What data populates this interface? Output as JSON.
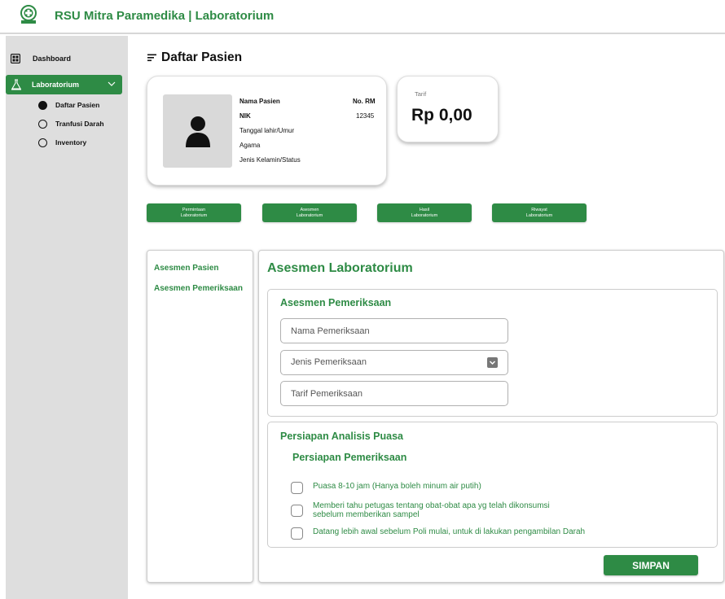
{
  "app": {
    "title": "RSU Mitra Paramedika | Laboratorium",
    "logo_icon": "hospital-logo-icon",
    "brand_color": "#2e8b45"
  },
  "sidebar": {
    "dashboard": {
      "label": "Dashboard",
      "icon": "dashboard-grid-icon"
    },
    "laboratorium": {
      "label": "Laboratorium",
      "icon": "lab-icon",
      "expanded": true
    },
    "sub_items": [
      {
        "label": "Daftar Pasien",
        "selected": true
      },
      {
        "label": "Tranfusi Darah",
        "selected": false
      },
      {
        "label": "Inventory",
        "selected": false
      }
    ]
  },
  "page": {
    "title": "Daftar Pasien",
    "title_icon": "list-lines-icon"
  },
  "patient": {
    "name_label": "Nama Pasien",
    "nik_label": "NIK",
    "birth_label": "Tanggal lahir/Umur",
    "religion_label": "Agama",
    "gender_label": "Jenis Kelamin/Status",
    "rm_label": "No. RM",
    "rm_value": "12345",
    "avatar_icon": "user-silhouette-icon"
  },
  "tariff": {
    "label": "Tarif",
    "value": "Rp 0,00"
  },
  "tabs": [
    {
      "line1": "Permintaan",
      "line2": "Laboratorium"
    },
    {
      "line1": "Asesmen",
      "line2": "Laboratorium"
    },
    {
      "line1": "Hasil",
      "line2": "Laboratorium"
    },
    {
      "line1": "Riwayat",
      "line2": "Laboratorium"
    }
  ],
  "left_menu": [
    {
      "label": "Asesmen Pasien"
    },
    {
      "label": "Asesmen Pemeriksaan"
    }
  ],
  "main": {
    "title": "Asesmen Laboratorium",
    "section1": {
      "title": "Asesmen Pemeriksaan",
      "name_placeholder": "Nama Pemeriksaan",
      "type_value": "Jenis Pemeriksaan",
      "tariff_placeholder": "Tarif Pemeriksaan"
    },
    "section2": {
      "title": "Persiapan Analisis Puasa",
      "subtitle": "Persiapan Pemeriksaan",
      "checks": [
        {
          "line1": "Puasa 8-10 jam (Hanya boleh minum air putih)",
          "line2": "",
          "checked": false
        },
        {
          "line1": "Memberi tahu petugas tentang obat-obat apa yg telah dikonsumsi",
          "line2": "sebelum memberikan sampel",
          "checked": false
        },
        {
          "line1": "Datang lebih awal sebelum Poli mulai, untuk di lakukan pengambilan Darah",
          "line2": "",
          "checked": false
        }
      ]
    },
    "save_label": "SIMPAN"
  }
}
